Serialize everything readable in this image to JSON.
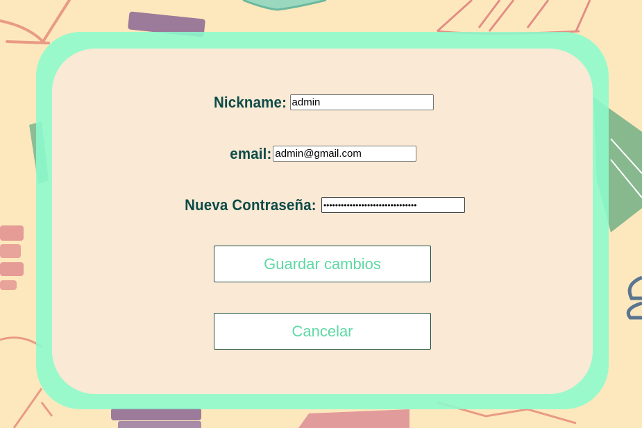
{
  "form": {
    "nickname": {
      "label": "Nickname:",
      "value": "admin"
    },
    "email": {
      "label": "email:",
      "value": "admin@gmail.com"
    },
    "password": {
      "label": "Nueva Contraseña:",
      "value": "********************************"
    }
  },
  "buttons": {
    "save_label": "Guardar cambios",
    "cancel_label": "Cancelar"
  },
  "colors": {
    "background": "#fde8bd",
    "card_border": "#8cfacd",
    "card_fill": "#f9e9d5",
    "label_text": "#0d4b48",
    "button_text": "#5fd9a4"
  },
  "icons": [
    "book-icon",
    "book-stack-icon"
  ]
}
